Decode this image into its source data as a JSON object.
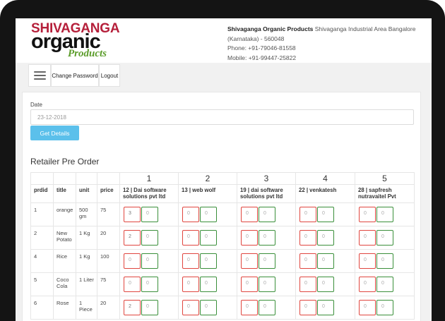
{
  "brand": {
    "logo_line1": "SHIVAGANGA",
    "logo_line2": "organic",
    "logo_line3": "Products"
  },
  "contact": {
    "company": "Shivaganga Organic Products",
    "address": " Shivaganga Industrial Area Bangalore (Karnataka) - 560048",
    "phone": "Phone: +91-79046-81558",
    "mobile": "Mobile: +91-99447-25822"
  },
  "nav": {
    "change_password": "Change Password",
    "logout": "Logout"
  },
  "form": {
    "date_label": "Date",
    "date_value": "23-12-2018",
    "get_details": "Get Details"
  },
  "section_title": "Retailer Pre Order",
  "table": {
    "columns": [
      "prdid",
      "title",
      "unit",
      "price"
    ],
    "retailer_numbers": [
      "1",
      "2",
      "3",
      "4",
      "5"
    ],
    "retailers": [
      "12 | Dai software solutions pvt ltd",
      "13 | web wolf",
      "19 | dai software solutions pvt ltd",
      "22 | venkatesh",
      "28 | sapfresh nutravaitel Pvt"
    ],
    "rows": [
      {
        "prdid": "1",
        "title": "orange",
        "unit": "500 gm",
        "price": "75",
        "qty": [
          [
            "3",
            "0"
          ],
          [
            "0",
            "0"
          ],
          [
            "0",
            "0"
          ],
          [
            "0",
            "0"
          ],
          [
            "0",
            "0"
          ]
        ]
      },
      {
        "prdid": "2",
        "title": "New Potato",
        "unit": "1 Kg",
        "price": "20",
        "qty": [
          [
            "2",
            "0"
          ],
          [
            "0",
            "0"
          ],
          [
            "0",
            "0"
          ],
          [
            "0",
            "0"
          ],
          [
            "0",
            "0"
          ]
        ]
      },
      {
        "prdid": "4",
        "title": "Rice",
        "unit": "1 Kg",
        "price": "100",
        "qty": [
          [
            "0",
            "0"
          ],
          [
            "0",
            "0"
          ],
          [
            "0",
            "0"
          ],
          [
            "0",
            "0"
          ],
          [
            "0",
            "0"
          ]
        ]
      },
      {
        "prdid": "5",
        "title": "Coco Cola",
        "unit": "1 Liter",
        "price": "75",
        "qty": [
          [
            "0",
            "0"
          ],
          [
            "0",
            "0"
          ],
          [
            "0",
            "0"
          ],
          [
            "0",
            "0"
          ],
          [
            "0",
            "0"
          ]
        ]
      },
      {
        "prdid": "6",
        "title": "Rose",
        "unit": "1 Piece",
        "price": "20",
        "qty": [
          [
            "2",
            "0"
          ],
          [
            "0",
            "0"
          ],
          [
            "0",
            "0"
          ],
          [
            "0",
            "0"
          ],
          [
            "0",
            "0"
          ]
        ]
      }
    ]
  },
  "colors": {
    "accent_button": "#5bc0eb",
    "logo_red": "#b51f3a",
    "logo_green": "#5b9c2a",
    "qty_left_border": "#e0463f",
    "qty_right_border": "#3a8f3a"
  }
}
